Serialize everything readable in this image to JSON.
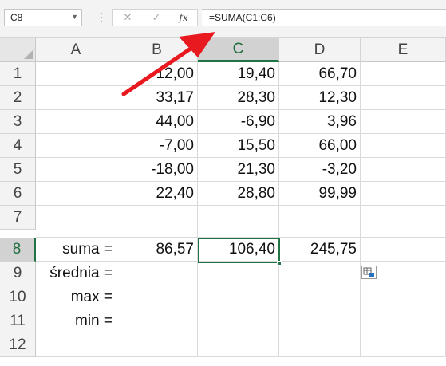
{
  "namebox": {
    "value": "C8",
    "dropdown_icon": "chevron-down-icon"
  },
  "formula_bar": {
    "cancel_label": "✕",
    "enter_label": "✓",
    "fx_label": "fx",
    "formula": "=SUMA(C1:C6)"
  },
  "columns": [
    "A",
    "B",
    "C",
    "D",
    "E"
  ],
  "rows": [
    "1",
    "2",
    "3",
    "4",
    "5",
    "6",
    "7",
    "8",
    "9",
    "10",
    "11",
    "12"
  ],
  "selected_column": "C",
  "selected_row": "8",
  "cells": {
    "B": [
      "12,00",
      "33,17",
      "44,00",
      "-7,00",
      "-18,00",
      "22,40",
      "",
      "86,57",
      "",
      "",
      "",
      ""
    ],
    "C": [
      "19,40",
      "28,30",
      "-6,90",
      "15,50",
      "21,30",
      "28,80",
      "",
      "106,40",
      "",
      "",
      "",
      ""
    ],
    "D": [
      "66,70",
      "12,30",
      "3,96",
      "66,00",
      "-3,20",
      "99,99",
      "",
      "245,75",
      "",
      "",
      "",
      ""
    ],
    "A": [
      "",
      "",
      "",
      "",
      "",
      "",
      "",
      "suma =",
      "średnia =",
      "max =",
      "min =",
      ""
    ]
  },
  "annotation": {
    "color": "#e8191f"
  },
  "colors": {
    "accent": "#217346"
  }
}
